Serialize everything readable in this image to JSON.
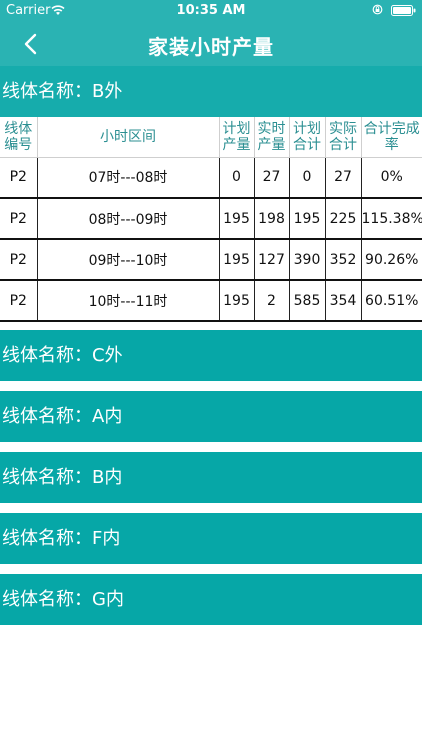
{
  "status_bar": {
    "carrier": "Carrier",
    "time": "10:35 AM"
  },
  "nav": {
    "title": "家装小时产量"
  },
  "lines": [
    {
      "name": "线体名称：B外",
      "table": {
        "headers": [
          [
            "线体",
            "编号"
          ],
          [
            "小时区间"
          ],
          [
            "计划",
            "产量"
          ],
          [
            "实时",
            "产量"
          ],
          [
            "计划",
            "合计"
          ],
          [
            "实际",
            "合计"
          ],
          [
            "合计完成",
            "率"
          ]
        ],
        "rows": [
          [
            "P2",
            "07时---08时",
            "0",
            "27",
            "0",
            "27",
            "0%"
          ],
          [
            "P2",
            "08时---09时",
            "195",
            "198",
            "195",
            "225",
            "115.38%"
          ],
          [
            "P2",
            "09时---10时",
            "195",
            "127",
            "390",
            "352",
            "90.26%"
          ],
          [
            "P2",
            "10时---11时",
            "195",
            "2",
            "585",
            "354",
            "60.51%"
          ]
        ]
      }
    },
    {
      "name": "线体名称：C外"
    },
    {
      "name": "线体名称：A内"
    },
    {
      "name": "线体名称：B内"
    },
    {
      "name": "线体名称：F内"
    },
    {
      "name": "线体名称：G内"
    }
  ]
}
